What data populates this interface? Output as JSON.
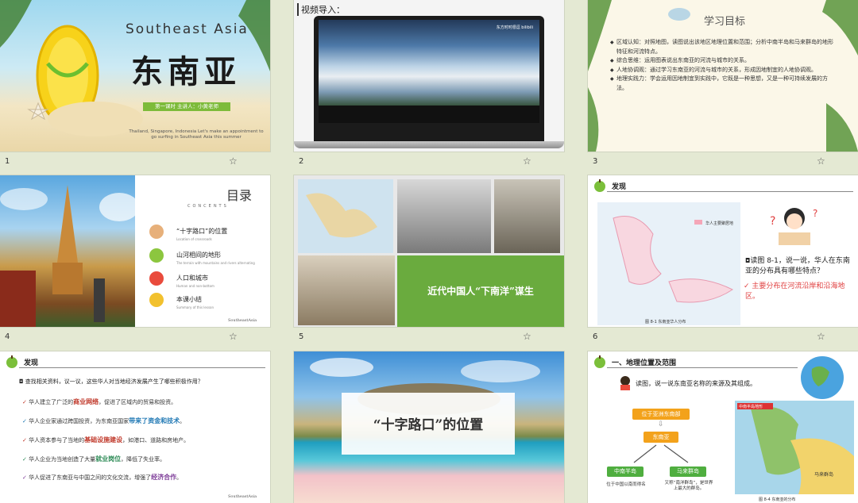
{
  "slides": [
    {
      "number": "1",
      "title_en": "Southeast Asia",
      "title_cn": "东南亚",
      "bar": "第一课时  主讲人：小黄老师",
      "subtitle": "Thailand, Singapore, Indonesia Let's make an appointment to go surfing in Southeast Asia this summer"
    },
    {
      "number": "2",
      "label": "视频导入：",
      "video_brand": "东方时时很逗 bilibili"
    },
    {
      "number": "3",
      "heading": "学习目标",
      "objectives": [
        "区域认知：对照地图，读图说出该地区地理位置和范围；分析中南半岛和马来群岛的地形特征和河流特点。",
        "综合思维：运用图表说出东南亚的河流与城市的关系。",
        "人地协调观：通过学习东南亚的河流与城市的关系，形成因地制宜的人地协调观。",
        "地理实践力：学会运用因地制宜到实践中，它既是一种思想，又是一种可持续发展的方法。"
      ]
    },
    {
      "number": "4",
      "toc_cn": "目录",
      "toc_en": "CONCENTS",
      "items": [
        {
          "label": "“十字路口”的位置",
          "sub": "Location of crossroads"
        },
        {
          "label": "山河相间的地形",
          "sub": "The terrain with mountains and rivers alternating"
        },
        {
          "label": "人口和城市",
          "sub": "Human and non-bottom"
        },
        {
          "label": "本课小结",
          "sub": "Summary of this lesson"
        }
      ],
      "footer": "SoutheastAsia"
    },
    {
      "number": "5",
      "caption": "近代中国人“下南洋”谋生"
    },
    {
      "number": "6",
      "header": "发现",
      "question": "读图 8-1，说一说，华人在东南亚的分布具有哪些特点？",
      "answer": "主要分布在河流沿岸和沿海地区。",
      "map_caption": "图 8-1  东南亚华人分布",
      "legend": "华人主要聚居地"
    },
    {
      "number": "7",
      "header": "发现",
      "intro": "查找相关资料，议一议，这些华人对当地经济发展产生了哪些积极作用？",
      "rows": [
        {
          "pre": "华人建立了广泛的",
          "bold": "商业网络",
          "post": "，促进了区域内的贸易和投资。",
          "color": "#c0392b"
        },
        {
          "pre": "华人企业家通过跨国投资，为东南亚国家",
          "bold": "带来了资金和技术",
          "post": "。",
          "color": "#1f78b4"
        },
        {
          "pre": "华人资本参与了当地的",
          "bold": "基础设施建设",
          "post": "，如港口、道路和房地产。",
          "color": "#c0392b"
        },
        {
          "pre": "华人企业为当地创造了大量",
          "bold": "就业岗位",
          "post": "，降低了失业率。",
          "color": "#2e8b57"
        },
        {
          "pre": "华人促进了东南亚与中国之间的文化交流，增强了",
          "bold": "经济合作",
          "post": "。",
          "color": "#7d3c98"
        }
      ],
      "footer": "SoutheastAsia"
    },
    {
      "number": "8",
      "title": "“十字路口”的位置"
    },
    {
      "number": "9",
      "header": "一、地理位置及范围",
      "read": "读图，说一说东南亚名称的来源及其组成。",
      "top_box": "位于亚洲东南部",
      "mid_box": "东南亚",
      "left_box": "中南半岛",
      "right_box": "马来群岛",
      "left_note": "位于中国以南而得名",
      "right_note": "又称“南洋群岛”，是世界上最大的群岛。",
      "map_title": "中南半岛地形",
      "map_label": "马来群岛",
      "map_caption": "图 8-4 东南亚的分布"
    }
  ]
}
